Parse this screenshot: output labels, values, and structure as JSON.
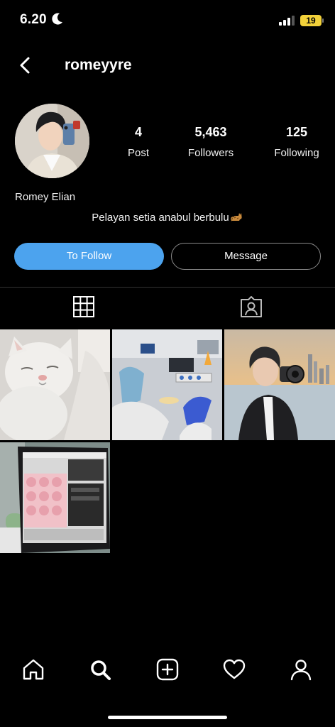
{
  "status_bar": {
    "time": "6.20",
    "battery": "19"
  },
  "header": {
    "username": "romeyyre"
  },
  "profile": {
    "posts_count": "4",
    "posts_label": "Post",
    "followers_count": "5,463",
    "followers_label": "Followers",
    "following_count": "125",
    "following_label": "Following",
    "full_name": "Romey Elian",
    "bio": "Pelayan setia anabul berbulu"
  },
  "actions": {
    "follow_label": "To Follow",
    "message_label": "Message"
  },
  "tabs": [
    "grid-icon",
    "tagged-icon"
  ],
  "posts": [
    {
      "name": "post-white-cat"
    },
    {
      "name": "post-lab-experiment"
    },
    {
      "name": "post-camera-portrait"
    },
    {
      "name": "post-laptop-screen"
    }
  ],
  "bottom_nav": [
    "home-icon",
    "search-icon",
    "create-icon",
    "heart-icon",
    "profile-icon"
  ],
  "colors": {
    "accent": "#4ca3ee",
    "background": "#000000",
    "battery": "#f2d13a"
  }
}
